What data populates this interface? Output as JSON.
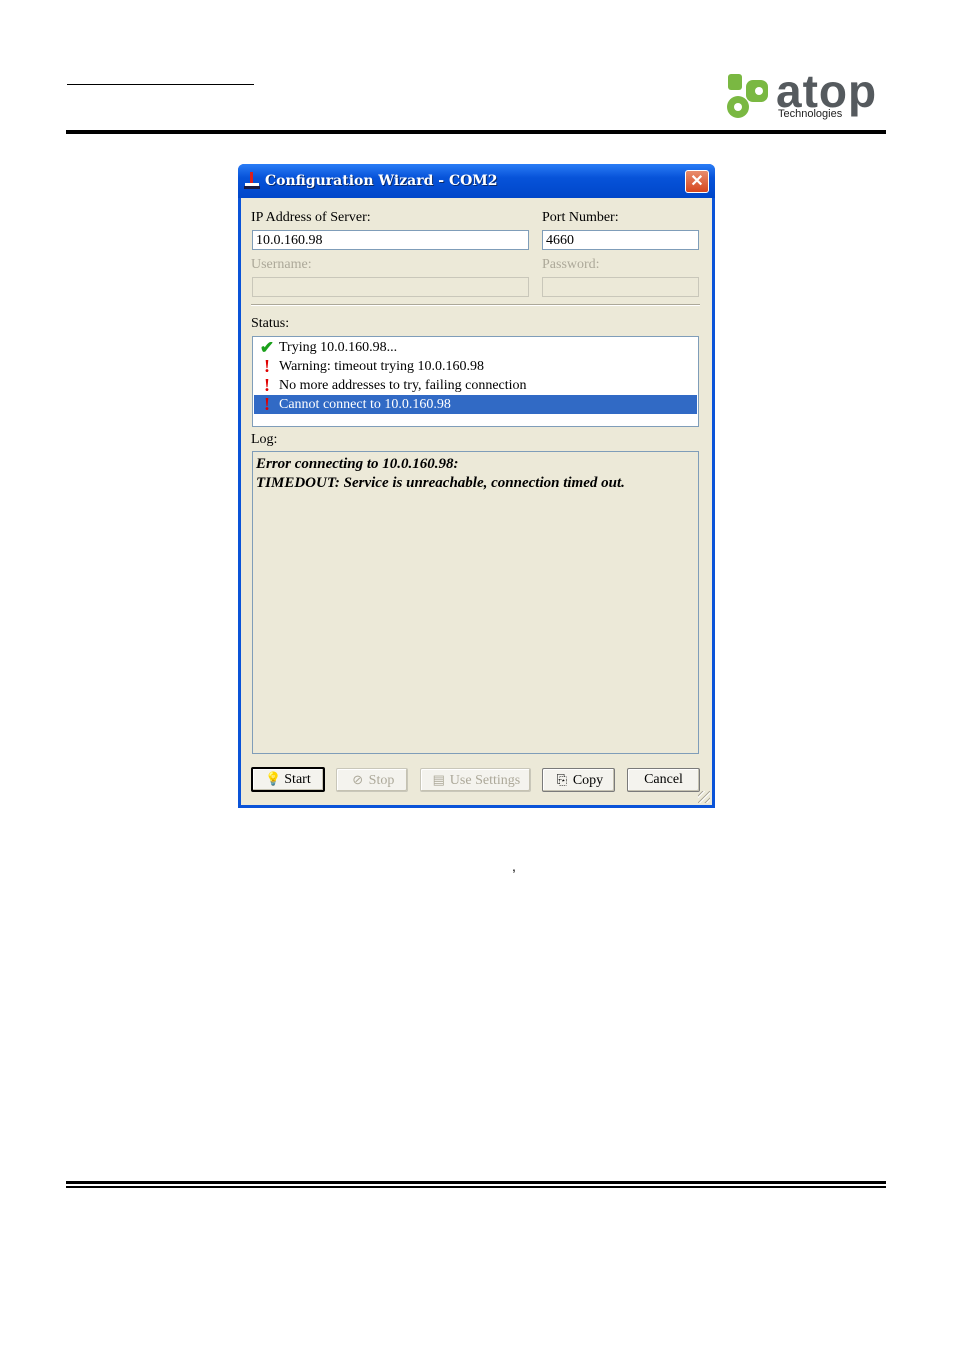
{
  "logo": {
    "name": "atop",
    "tagline": "Technologies",
    "colors": {
      "green": "#7ab842",
      "gray": "#555a5e"
    }
  },
  "dialog": {
    "title": "Configuration Wizard - COM2",
    "title_icon": "wizard-icon",
    "close_icon": "close-icon",
    "ip_label": "IP Address of Server:",
    "ip_value": "10.0.160.98",
    "port_label": "Port Number:",
    "port_value": "4660",
    "username_label": "Username:",
    "username_value": "",
    "password_label": "Password:",
    "password_value": "",
    "status_label": "Status:",
    "status_items": [
      {
        "icon": "checkmark-icon",
        "text": "Trying 10.0.160.98...",
        "selected": false
      },
      {
        "icon": "exclamation-icon",
        "text": "Warning: timeout trying 10.0.160.98",
        "selected": false
      },
      {
        "icon": "exclamation-icon",
        "text": "No more addresses to try, failing connection",
        "selected": false
      },
      {
        "icon": "exclamation-icon",
        "text": "Cannot connect to 10.0.160.98",
        "selected": true
      }
    ],
    "log_label": "Log:",
    "log_lines": [
      "Error connecting to 10.0.160.98:",
      "TIMEDOUT: Service is unreachable, connection timed out."
    ],
    "buttons": {
      "start": "Start",
      "stop": "Stop",
      "use_settings": "Use Settings",
      "copy": "Copy",
      "cancel": "Cancel"
    },
    "colors": {
      "titlebar": "#0753d9",
      "selection": "#316ac5",
      "face": "#ece9d8"
    }
  },
  "page": {
    "stray_mark": ","
  }
}
